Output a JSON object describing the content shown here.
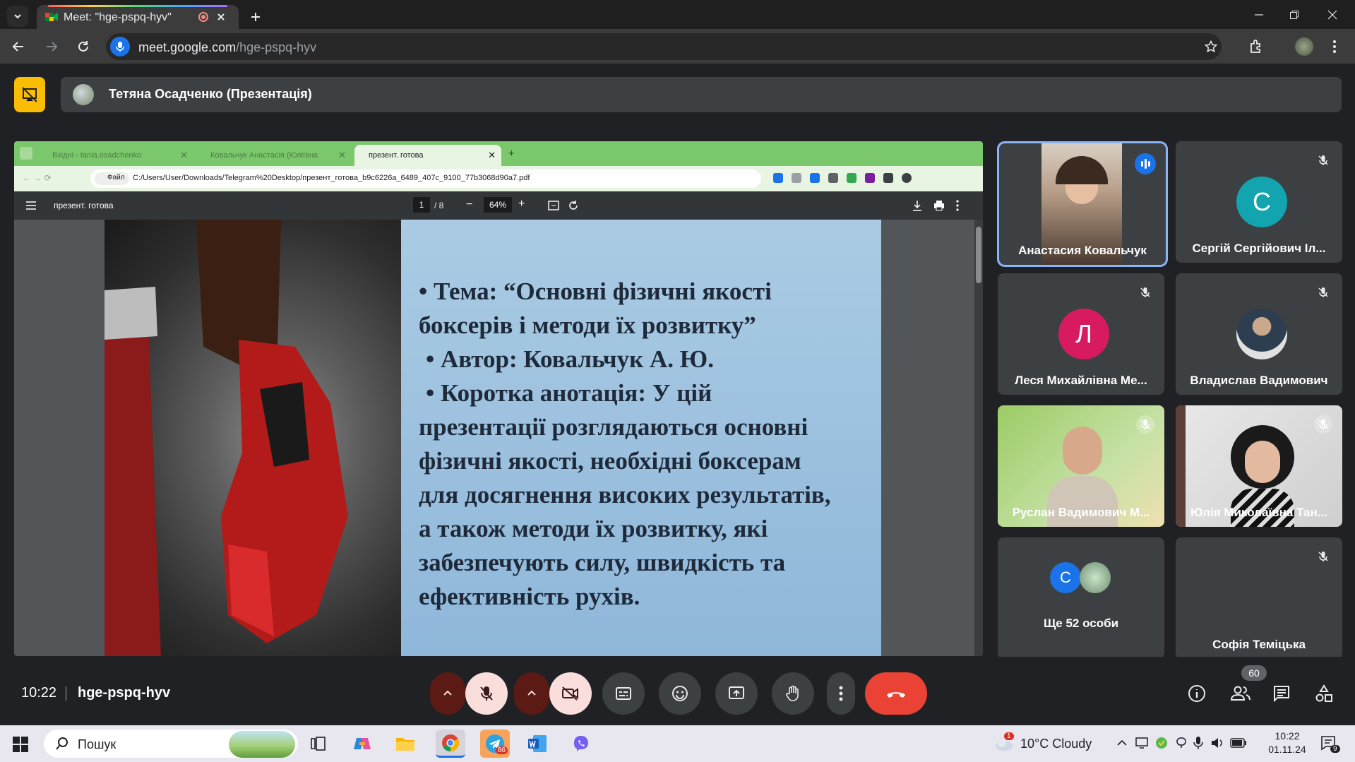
{
  "browser": {
    "tab_title": "Meet: \"hge-pspq-hyv\"",
    "url_host": "meet.google.com",
    "url_path": "/hge-pspq-hyv"
  },
  "meet": {
    "presenter_label": "Тетяна Осадченко (Презентація)",
    "clock": "10:22",
    "meeting_code": "hge-pspq-hyv",
    "participants_count": "60"
  },
  "shared_screen": {
    "tabs": [
      {
        "label": "Вхідні - tania.osadchenko"
      },
      {
        "label": "Ковальчук Анастасія (Юліївна"
      },
      {
        "label": "презент. готова"
      }
    ],
    "file_chip": "Файл",
    "url": "C:/Users/User/Downloads/Telegram%20Desktop/презент_готова_b9c6226a_6489_407c_9100_77b3068d90a7.pdf",
    "pdf_title": "презент. готова",
    "page_current": "1",
    "page_total": "/ 8",
    "zoom": "64%",
    "slide_lines": [
      "• Тема: “Основні фізичні якості",
      "боксерів і методи їх розвитку”",
      " • Автор: Ковальчук А. Ю.",
      " • Коротка анотація: У цій",
      "презентації розглядаються основні",
      "фізичні якості, необхідні боксерам",
      "для досягнення високих результатів,",
      "а також методи їх розвитку, які",
      "забезпечують силу, швидкість та",
      "ефективність рухів."
    ]
  },
  "participants": [
    {
      "name": "Анастасия Ковальчук",
      "type": "video",
      "speaking": true
    },
    {
      "name": "Сергій Сергійович Іл...",
      "initial": "С",
      "color": "#12a4af",
      "muted": true
    },
    {
      "name": "Леся Михайлівна Ме...",
      "initial": "Л",
      "color": "#d81b60",
      "muted": true
    },
    {
      "name": "Владислав Вадимович",
      "type": "avatar",
      "muted": true
    },
    {
      "name": "Руслан Вадимович М...",
      "type": "video",
      "muted": true
    },
    {
      "name": "Юлія Миколаївна Тан...",
      "type": "video",
      "muted": true
    },
    {
      "name": "Ще 52 особи",
      "initial": "С",
      "color": "#1a73e8"
    },
    {
      "name": "Софія Теміцька",
      "type": "avatar",
      "muted": true
    }
  ],
  "taskbar": {
    "search_placeholder": "Пошук",
    "weather": "10°C  Cloudy",
    "time": "10:22",
    "date": "01.11.24",
    "telegram_badge": "86",
    "notif_count": "9",
    "weather_badge": "1"
  },
  "colors": {
    "meet_bg": "#202124",
    "accent_blue": "#1a73e8",
    "hangup_red": "#ea4335",
    "present_yellow": "#fbbc04"
  }
}
